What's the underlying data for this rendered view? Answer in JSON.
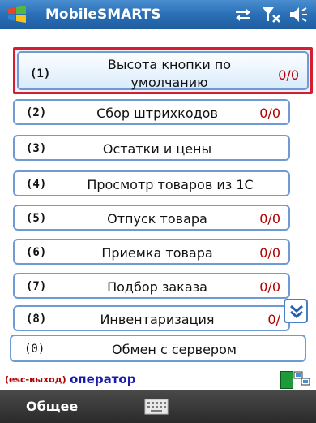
{
  "titlebar": {
    "app_title": "MobileSMARTS",
    "icons": [
      "windows-flag-icon",
      "connectivity-icon",
      "signal-off-icon",
      "volume-icon"
    ]
  },
  "menu": {
    "items": [
      {
        "num": "(1)",
        "label": "Высота кнопки по умолчанию",
        "count": "0/0",
        "selected": true
      },
      {
        "num": "(2)",
        "label": "Сбор штрихкодов",
        "count": "0/0"
      },
      {
        "num": "(3)",
        "label": "Остатки и цены",
        "count": ""
      },
      {
        "num": "(4)",
        "label": "Просмотр товаров из 1С",
        "count": ""
      },
      {
        "num": "(5)",
        "label": "Отпуск товара",
        "count": "0/0"
      },
      {
        "num": "(6)",
        "label": "Приемка товара",
        "count": "0/0"
      },
      {
        "num": "(7)",
        "label": "Подбор заказа",
        "count": "0/0"
      },
      {
        "num": "(8)",
        "label": "Инвентаризация",
        "count": "0/"
      }
    ],
    "exchange": {
      "num": "(0)",
      "label": "Обмен с сервером"
    },
    "scroll_icon": "chevron-double-down-icon"
  },
  "statusline": {
    "esc_hint": "(esc-выход)",
    "operator": "оператор"
  },
  "softbar": {
    "left_softkey": "Общее",
    "keyboard_icon": "keyboard-icon"
  },
  "colors": {
    "title_bar": "#2a6fb5",
    "item_border": "#6f9ad4",
    "selected_border": "#d21e2e",
    "count_color": "#b00000",
    "operator_color": "#1c1caa"
  }
}
